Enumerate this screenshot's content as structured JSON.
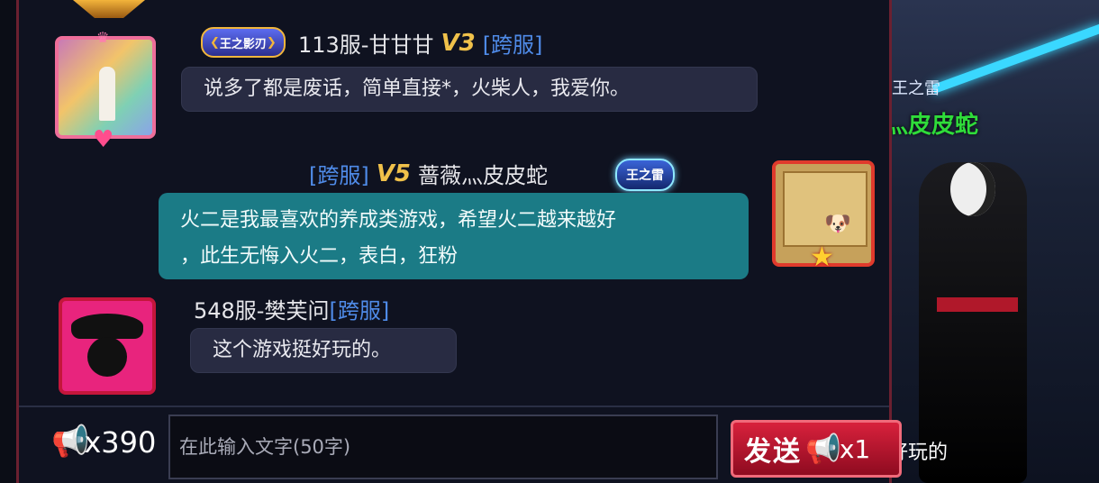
{
  "chat": {
    "messages": [
      {
        "badge": "王之影刃",
        "name": "113服-甘甘甘",
        "vip": "V3",
        "server_tag": "[跨服]",
        "text": "说多了都是废话，简单直接*，火柴人，我爱你。"
      },
      {
        "server_tag": "[跨服]",
        "vip": "V5",
        "name": "蔷薇灬皮皮蛇",
        "badge": "王之雷",
        "text_line1": "火二是我最喜欢的养成类游戏，希望火二越来越好",
        "text_line2": "，此生无悔入火二，表白，狂粉"
      },
      {
        "name": "548服-樊芙问",
        "server_tag": "[跨服]",
        "text": "这个游戏挺好玩的。"
      }
    ]
  },
  "input": {
    "placeholder": "在此输入文字(50字)"
  },
  "horn": {
    "icon": "megaphone-icon",
    "count": "x390"
  },
  "send_button": {
    "label": "发送",
    "cost": "x1"
  },
  "scene": {
    "title": "王之雷",
    "player_name": "蔷薇灬皮皮蛇",
    "floating_msg": "好玩的"
  },
  "colors": {
    "vip_gold": "#f0c14a",
    "server_blue": "#4f8be8",
    "teal_bubble": "#1b7b86",
    "dark_bubble": "#282b42",
    "send_red": "#d8213c"
  }
}
